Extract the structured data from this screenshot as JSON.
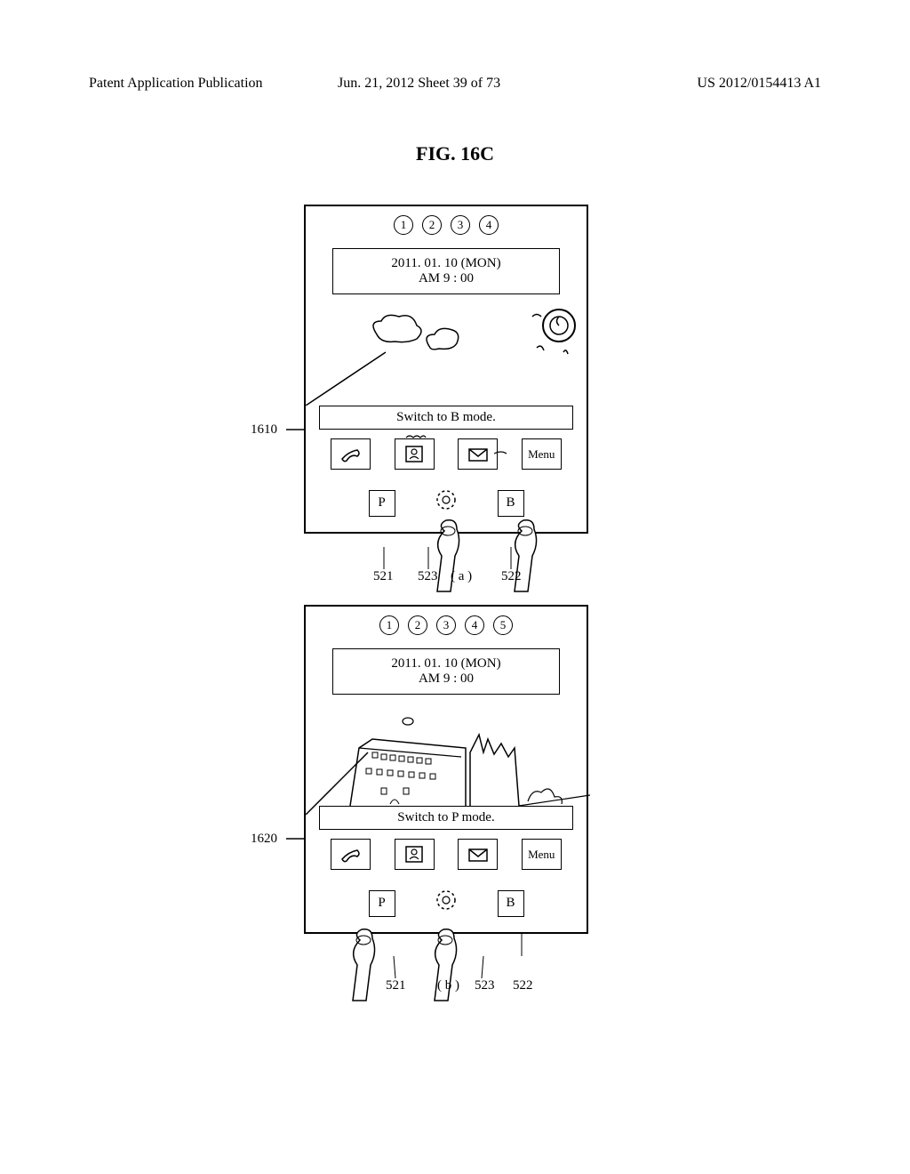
{
  "header": {
    "left": "Patent Application Publication",
    "center": "Jun. 21, 2012  Sheet 39 of 73",
    "right": "US 2012/0154413 A1"
  },
  "figure_title": "FIG. 16C",
  "panel_a": {
    "circles": [
      "1",
      "2",
      "3",
      "4"
    ],
    "date": "2011. 01. 10 (MON)",
    "time": "AM 9 : 00",
    "switch_text": "Switch to B mode.",
    "menu_label": "Menu",
    "mode_p": "P",
    "mode_b": "B",
    "ref_left": "1610",
    "ref_521": "521",
    "ref_523": "523",
    "ref_522": "522",
    "sub": "( a )"
  },
  "panel_b": {
    "circles": [
      "1",
      "2",
      "3",
      "4",
      "5"
    ],
    "date": "2011. 01. 10 (MON)",
    "time": "AM 9 : 00",
    "switch_text": "Switch to P mode.",
    "menu_label": "Menu",
    "mode_p": "P",
    "mode_b": "B",
    "ref_left": "1620",
    "ref_521": "521",
    "ref_523": "523",
    "ref_522": "522",
    "sub": "( b )"
  }
}
